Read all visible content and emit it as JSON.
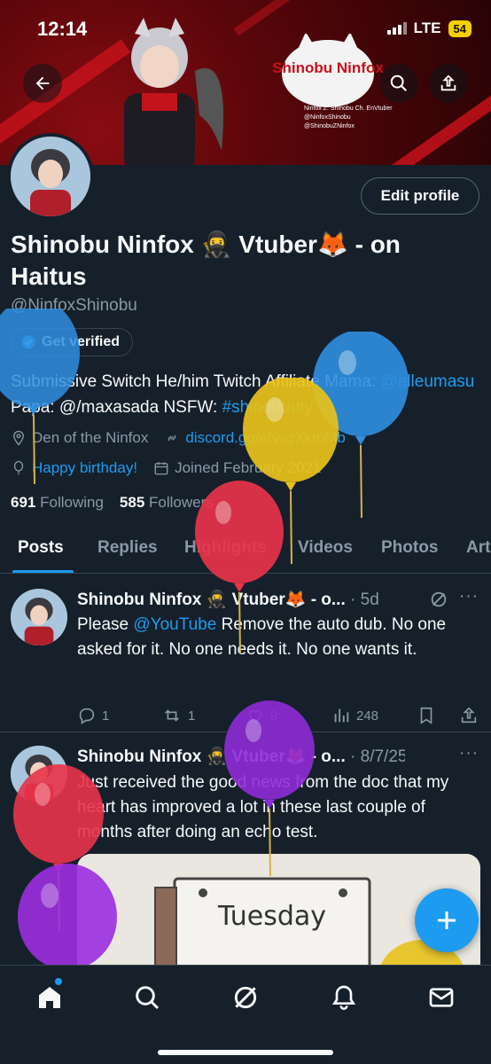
{
  "status": {
    "time": "12:14",
    "network": "LTE",
    "battery": "54"
  },
  "banner": {
    "logo_title": "Shinobu Ninfox",
    "logo_lines": [
      "Ninfox Z. Shinobu Ch. EnVtuber",
      "@NinfoxShinobu",
      "@ShinobuZNinfox"
    ]
  },
  "profile": {
    "edit_label": "Edit profile",
    "display_name": "Shinobu Ninfox 🥷 Vtuber🦊 - on Haitus",
    "handle": "@NinfoxShinobu",
    "verify_label": "Get verified",
    "bio_text": "Submissive Switch He/him Twitch Affiliate Mama: ",
    "bio_mama": "@alleumasu",
    "bio_papa_text": " Papa: @/maxasada NSFW: ",
    "bio_tag": "#shinobuuty",
    "location": "Den of the Ninfox",
    "website": "discord.gg/eNvgXkmMb",
    "birthday": "Happy birthday!",
    "joined": "Joined February 2021",
    "following_count": "691",
    "following_label": "Following",
    "followers_count": "585",
    "followers_label": "Followers"
  },
  "tabs": [
    "Posts",
    "Replies",
    "Highlights",
    "Videos",
    "Photos",
    "Art"
  ],
  "posts": [
    {
      "name": "Shinobu Ninfox 🥷 Vtuber🦊 - o...",
      "time": "5d",
      "text_pre": "Please ",
      "text_link": "@YouTube",
      "text_post": " Remove the auto dub. No one asked for it. No one needs it. No one wants it.",
      "replies": "1",
      "reposts": "1",
      "likes": "9",
      "views": "248"
    },
    {
      "name": "Shinobu Ninfox 🥷 Vtuber🦊 - o...",
      "time": "8/7/25",
      "text": "Just received the good news from the doc that my heart has improved a lot in these last couple of months after doing an echo test.",
      "media_text": "Tuesday"
    }
  ],
  "colors": {
    "background": "#15202b",
    "accent": "#1d9bf0",
    "muted": "#8b98a5",
    "balloons": [
      "#2f8fe0",
      "#e8c21a",
      "#e8334a",
      "#8e2bd6",
      "#9b2ee0"
    ]
  },
  "nav": {
    "icons": [
      "home-icon",
      "search-icon",
      "grok-icon",
      "notifications-icon",
      "messages-icon"
    ]
  }
}
